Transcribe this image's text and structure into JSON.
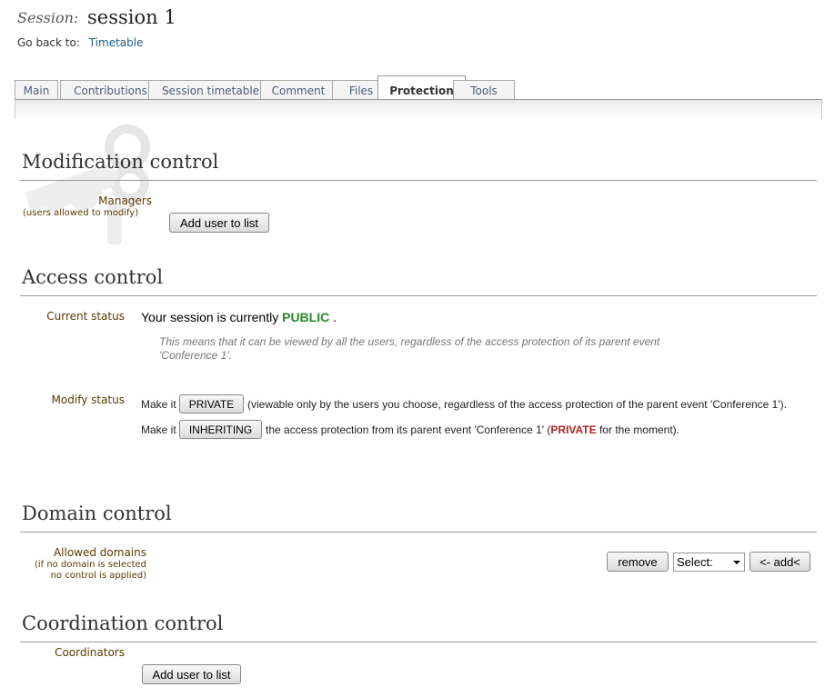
{
  "header": {
    "session_label": "Session:",
    "session_name": "session 1",
    "goback_label": "Go back to:",
    "goback_link": "Timetable"
  },
  "tabs": [
    "Main",
    "Contributions",
    "Session timetable",
    "Comment",
    "Files",
    "Protection",
    "Tools"
  ],
  "active_tab": "Protection",
  "modification": {
    "title": "Modification control",
    "managers_label": "Managers",
    "managers_sub": "(users allowed to modify)",
    "add_user_button": "Add user to list",
    "key_icon": "key-icon"
  },
  "access": {
    "title": "Access control",
    "current_status_label": "Current status",
    "status_prefix": "Your session is currently",
    "status_value": "PUBLIC",
    "status_suffix": ".",
    "status_color": "#2a8a2a",
    "explanation": "This means that it can be viewed by all the users, regardless of the access protection of its parent event 'Conference 1'.",
    "modify_status_label": "Modify status",
    "make_it": "Make it",
    "private_button": "PRIVATE",
    "private_desc": "(viewable only by the users you choose, regardless of the access protection of the parent event 'Conference 1').",
    "make_it_2": "Make it",
    "inheriting_button": "INHERITING",
    "inheriting_desc_pre": "the access protection from its parent event 'Conference 1' (",
    "inheriting_private": "PRIVATE",
    "inheriting_desc_post": " for the moment).",
    "private_color": "#b22222"
  },
  "domain": {
    "title": "Domain control",
    "allowed_label": "Allowed domains",
    "sub_line1": "(if no domain is selected",
    "sub_line2": "no control is applied)",
    "remove_button": "remove",
    "select_value": "Select:",
    "add_button": "<- add<"
  },
  "coordination": {
    "title": "Coordination control",
    "coordinators_label": "Coordinators",
    "add_user_button": "Add user to list"
  }
}
